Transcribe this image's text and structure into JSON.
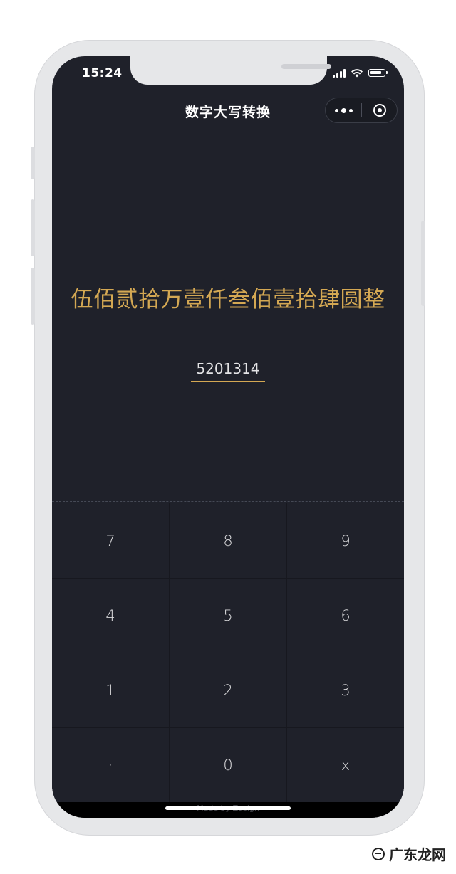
{
  "status_bar": {
    "time": "15:24"
  },
  "nav": {
    "title": "数字大写转换"
  },
  "result": {
    "text": "伍佰贰拾万壹仟叁佰壹拾肆圆整"
  },
  "input": {
    "value": "5201314"
  },
  "keypad": {
    "keys": [
      "7",
      "8",
      "9",
      "4",
      "5",
      "6",
      "1",
      "2",
      "3",
      "·",
      "0",
      "x"
    ]
  },
  "footer": {
    "text": "Made by Zusign"
  },
  "watermark": {
    "text": "广东龙网"
  }
}
